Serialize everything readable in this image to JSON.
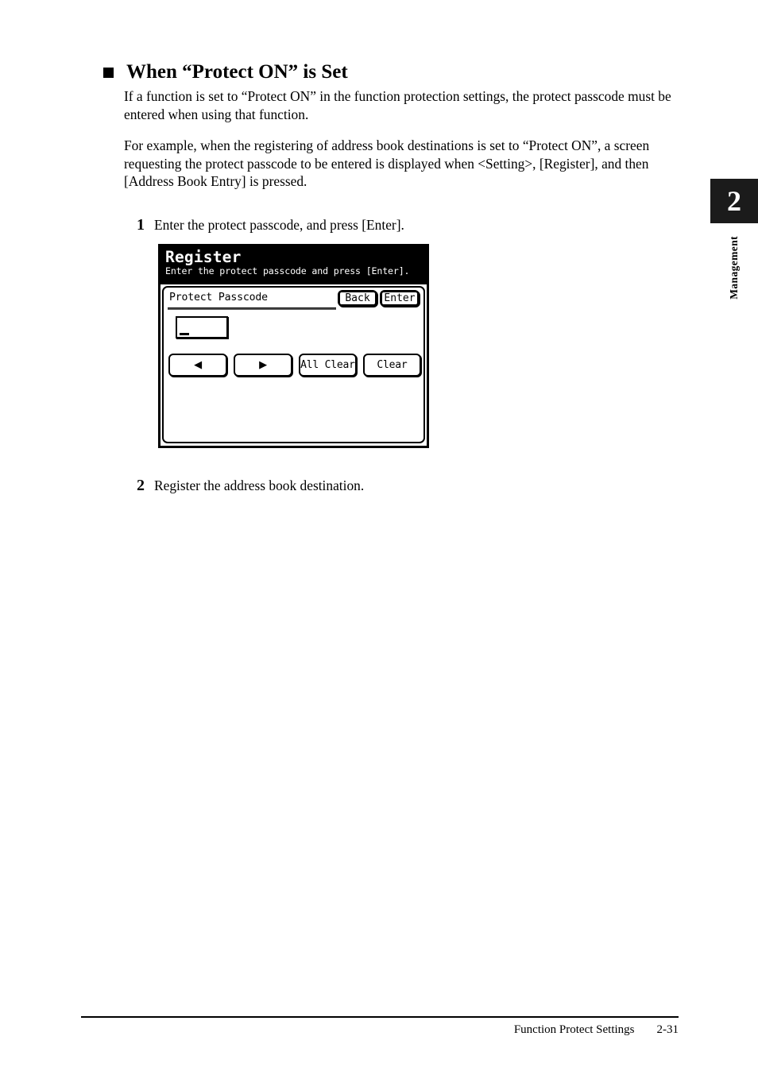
{
  "chapter_tab": {
    "number": "2",
    "label": "Management"
  },
  "heading": {
    "bullet": "square-bullet",
    "text": "When “Protect ON” is Set"
  },
  "paragraphs": [
    "If a function is set to “Protect ON” in the function protection settings, the protect passcode must be entered when using that function.",
    "For example, when the registering of address book destinations is set to “Protect ON”, a screen requesting the protect passcode to be entered is displayed when <Setting>, [Register], and then [Address Book Entry] is pressed."
  ],
  "steps": [
    {
      "number": "1",
      "text": "Enter the protect passcode, and press [Enter]."
    },
    {
      "number": "2",
      "text": "Register the address book destination."
    }
  ],
  "device_screen": {
    "title": "Register",
    "subtitle": "Enter the protect passcode and press [Enter].",
    "field_label": "Protect Passcode",
    "passcode_value": "",
    "header_buttons": [
      {
        "label": "Back"
      },
      {
        "label": "Enter"
      }
    ],
    "keypad_buttons": [
      {
        "label": "◀",
        "name": "left-arrow"
      },
      {
        "label": "▶",
        "name": "right-arrow"
      },
      {
        "label": "All Clear",
        "name": "all-clear"
      },
      {
        "label": "Clear",
        "name": "clear"
      }
    ]
  },
  "footer": {
    "section": "Function Protect Settings",
    "page": "2-31"
  },
  "colors": {
    "ink": "#000000",
    "paper": "#ffffff",
    "tab_black": "#1b1b1b"
  }
}
